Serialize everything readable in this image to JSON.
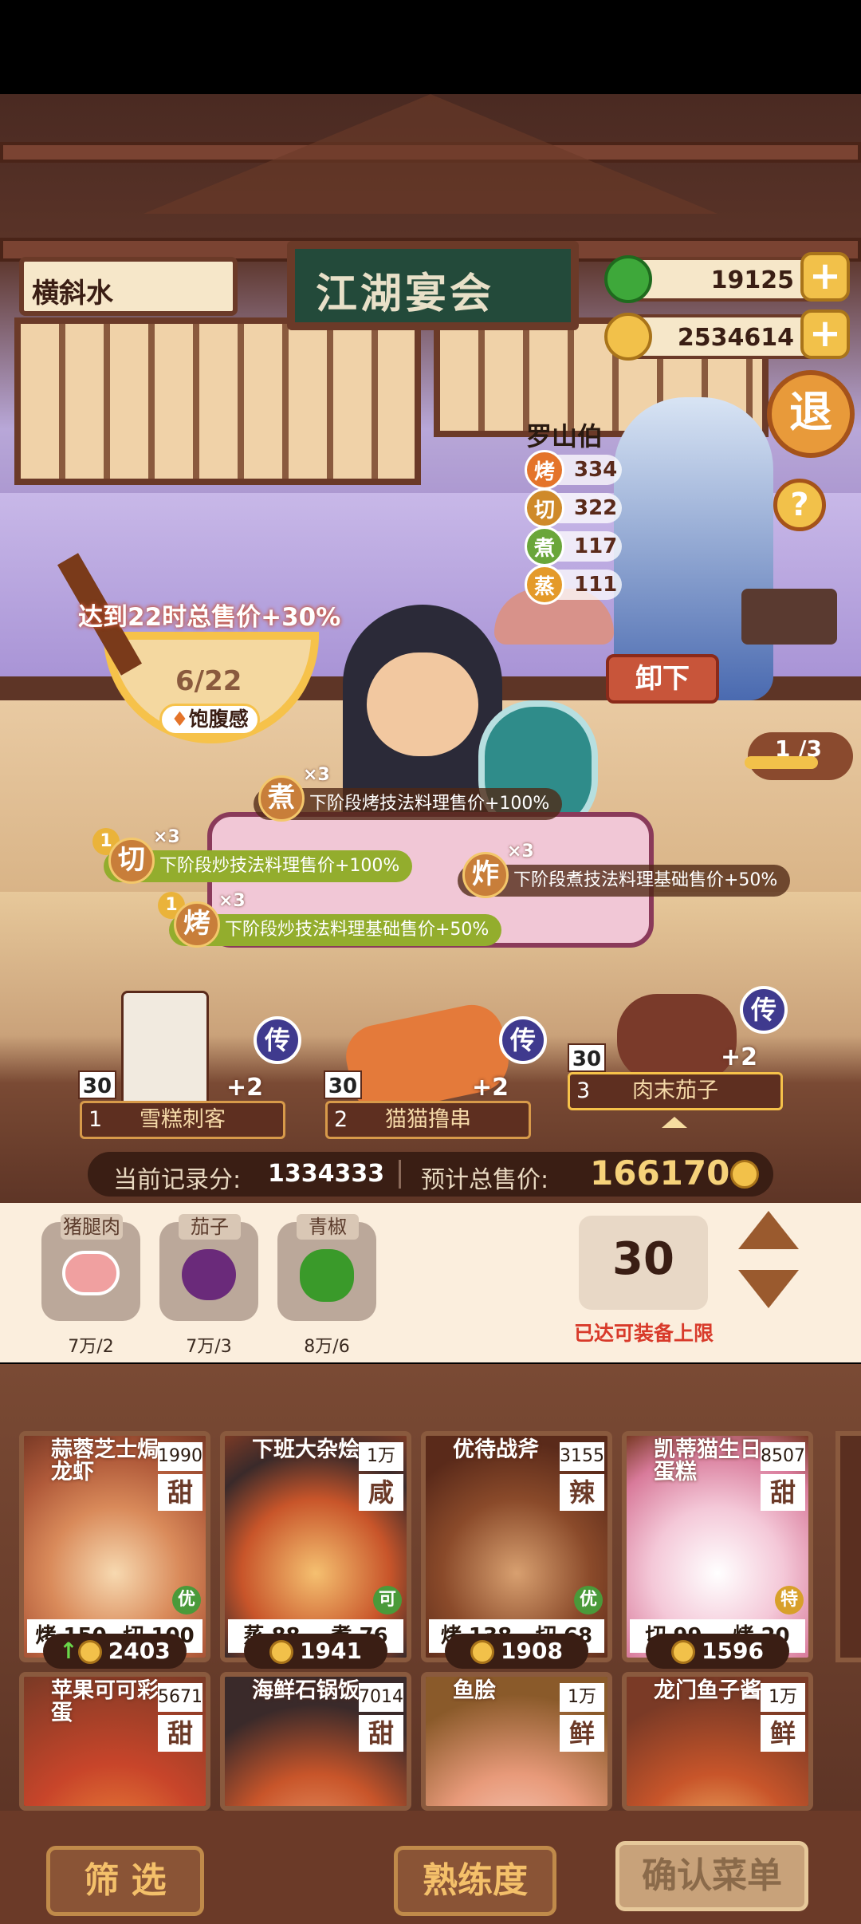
{
  "header": {
    "name_box": "横斜水",
    "sign": "江湖宴会",
    "jade_amount": "19125",
    "coin_amount": "2534614",
    "exit_label": "退",
    "help_label": "?"
  },
  "character": {
    "name": "罗山伯",
    "stats": [
      {
        "icon": "烤",
        "value": "334",
        "color": "#e4742a"
      },
      {
        "icon": "切",
        "value": "322",
        "color": "#cf8a2a"
      },
      {
        "icon": "煮",
        "value": "117",
        "color": "#6aa63a"
      },
      {
        "icon": "蒸",
        "value": "111",
        "color": "#e49a2a"
      }
    ],
    "unload_label": "卸下"
  },
  "bowl": {
    "goal_text": "达到22时总售价+30%",
    "progress": "6/22",
    "progress_fraction": 0.27,
    "label": "饱腹感"
  },
  "page_indicator": "1 /3",
  "buffs": [
    {
      "icon": "煮",
      "count": "",
      "multiplier": "×3",
      "text": "下阶段烤技法料理售价+100%",
      "style": "dark"
    },
    {
      "icon": "切",
      "count": "1",
      "multiplier": "×3",
      "text": "下阶段炒技法料理售价+100%",
      "style": "green"
    },
    {
      "icon": "炸",
      "count": "",
      "multiplier": "×3",
      "text": "下阶段煮技法料理基础售价+50%",
      "style": "dark"
    },
    {
      "icon": "烤",
      "count": "1",
      "multiplier": "×3",
      "text": "下阶段炒技法料理基础售价+50%",
      "style": "green"
    }
  ],
  "dish_slots": [
    {
      "index": "1",
      "name": "雪糕刺客",
      "qty": "30",
      "bonus": "+2",
      "rank": "传"
    },
    {
      "index": "2",
      "name": "猫猫撸串",
      "qty": "30",
      "bonus": "+2",
      "rank": "传"
    },
    {
      "index": "3",
      "name": "肉末茄子",
      "qty": "30",
      "bonus": "+2",
      "rank": "传"
    }
  ],
  "score_bar": {
    "record_label": "当前记录分:",
    "record_value": "1334333",
    "total_label": "预计总售价:",
    "total_value": "166170"
  },
  "ingredients": [
    {
      "name": "猪腿肉",
      "count": "7万/2",
      "color": "#e88a8a"
    },
    {
      "name": "茄子",
      "count": "7万/3",
      "color": "#7a3a8a"
    },
    {
      "name": "青椒",
      "count": "8万/6",
      "color": "#4aa23a"
    }
  ],
  "quantity": {
    "value": "30",
    "notice": "已达可装备上限"
  },
  "recipes": [
    {
      "name": "蒜蓉芝士焗龙虾",
      "price": "1990",
      "taste": "甜",
      "quality": "优",
      "quality_color": "#4a9a3a",
      "skill1": "烤",
      "val1": "150",
      "skill2": "切",
      "val2": "100",
      "sale": "2403"
    },
    {
      "name": "下班大杂烩",
      "price": "1万",
      "taste": "咸",
      "quality": "可",
      "quality_color": "#4a9a3a",
      "skill1": "蒸",
      "val1": "88",
      "skill2": "煮",
      "val2": "76",
      "sale": "1941"
    },
    {
      "name": "优待战斧",
      "price": "3155",
      "taste": "辣",
      "quality": "优",
      "quality_color": "#4a9a3a",
      "skill1": "烤",
      "val1": "138",
      "skill2": "切",
      "val2": "68",
      "sale": "1908"
    },
    {
      "name": "凯蒂猫生日蛋糕",
      "price": "8507",
      "taste": "甜",
      "quality": "特",
      "quality_color": "#d8a02a",
      "skill1": "切",
      "val1": "99",
      "skill2": "烤",
      "val2": "20",
      "sale": "1596"
    },
    {
      "name": "苹果可可彩蛋",
      "price": "5671",
      "taste": "甜"
    },
    {
      "name": "海鲜石锅饭",
      "price": "7014",
      "taste": "甜"
    },
    {
      "name": "鱼脍",
      "price": "1万",
      "taste": "鲜"
    },
    {
      "name": "龙门鱼子酱",
      "price": "1万",
      "taste": "鲜"
    }
  ],
  "bottom": {
    "filter": "筛 选",
    "proficiency": "熟练度",
    "confirm": "确认菜单"
  }
}
